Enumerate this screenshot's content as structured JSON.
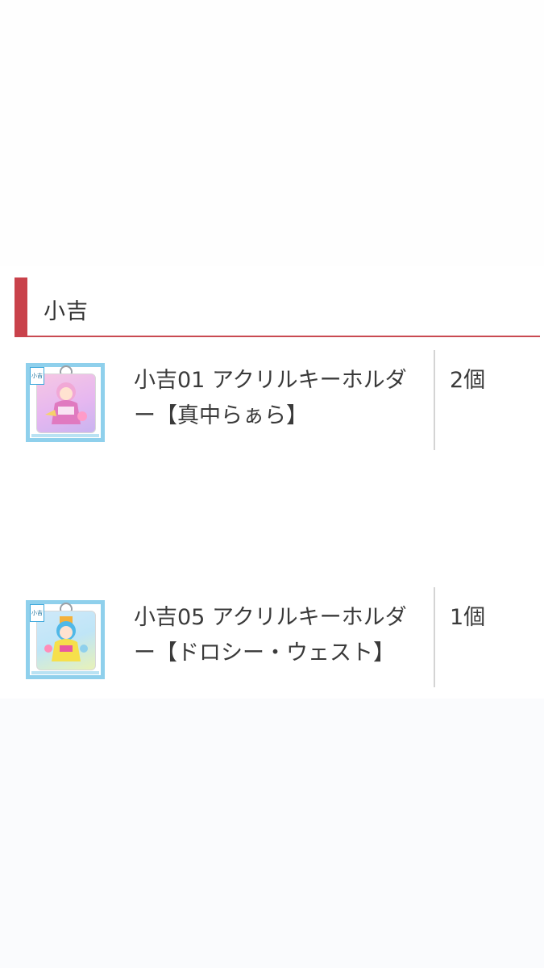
{
  "section": {
    "title": "小吉"
  },
  "items": [
    {
      "name": "小吉01 アクリルキーホルダー【真中らぁら】",
      "quantity": "2個",
      "badge": "小吉",
      "colors": {
        "frame": "#8fd0ec",
        "bg_top": "#f6c7e3",
        "bg_bottom": "#c9b4f0",
        "figure": "#e07ac0"
      }
    },
    {
      "name": "小吉05 アクリルキーホルダー【ドロシー・ウェスト】",
      "quantity": "1個",
      "badge": "小吉",
      "colors": {
        "frame": "#8fd0ec",
        "bg_top": "#bfe5f7",
        "bg_bottom": "#e8f2b7",
        "figure": "#4fb8e8"
      }
    }
  ],
  "accent_color": "#c9424b"
}
